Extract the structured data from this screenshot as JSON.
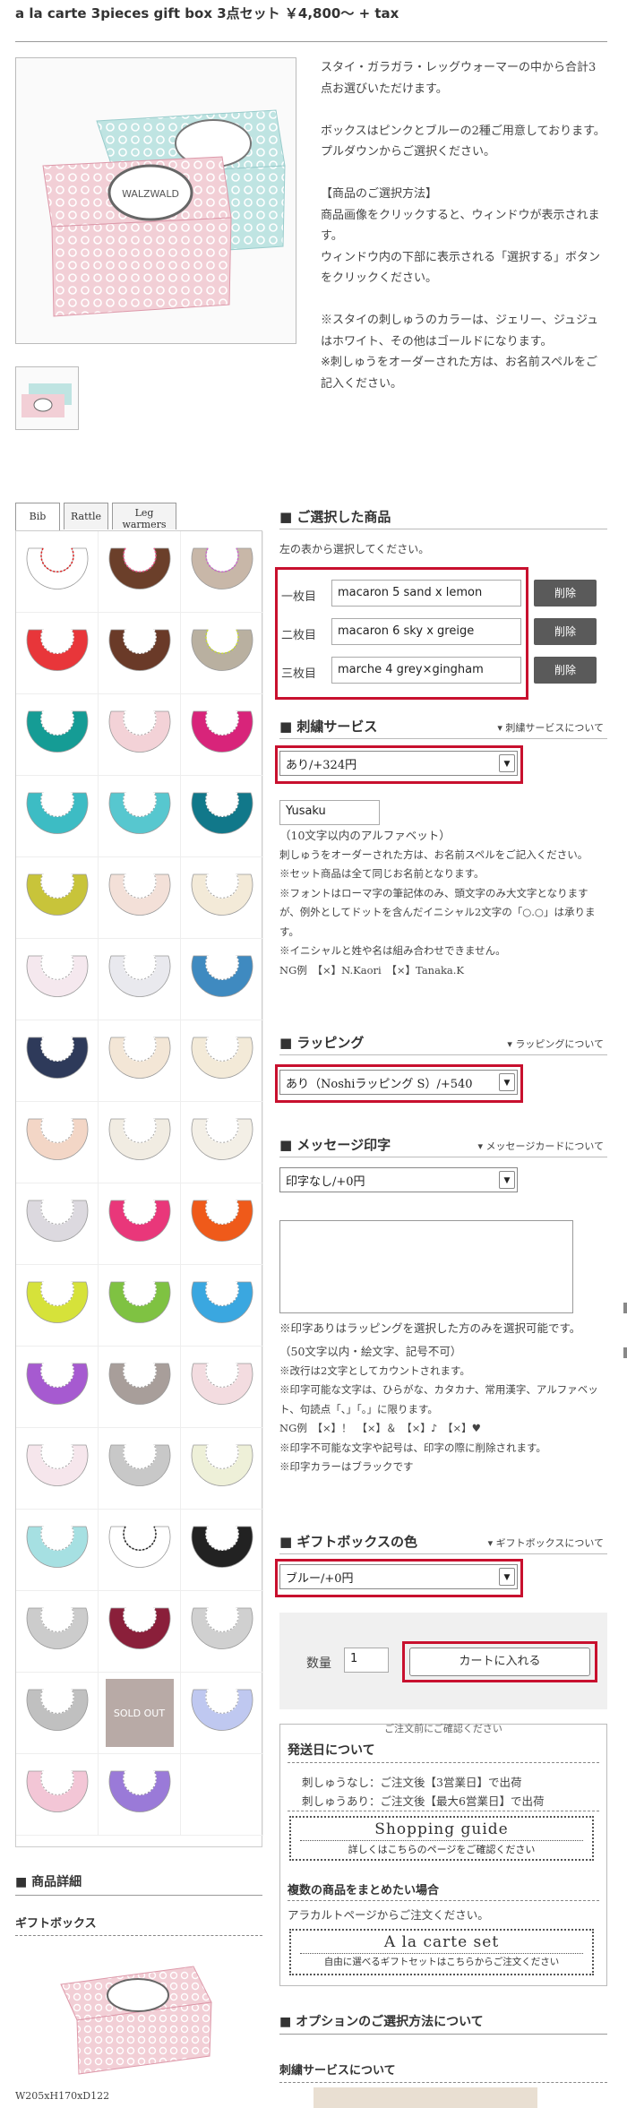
{
  "product_title": "a la carte 3pieces gift box 3点セット ￥4,800～ + tax",
  "description": [
    "スタイ・ガラガラ・レッグウォーマーの中から合計3点お選びいただけます。",
    "ボックスはピンクとブルーの2種ご用意しております。プルダウンからご選択ください。",
    "【商品のご選択方法】\n商品画像をクリックすると、ウィンドウが表示されます。\nウィンドウ内の下部に表示される「選択する」ボタンをクリックください。",
    "※スタイの刺しゅうのカラーは、ジェリー、ジュジュはホワイト、その他はゴールドになります。\n※刺しゅうをオーダーされた方は、お名前スペルをご記入ください。"
  ],
  "box_label": "WALZWALD",
  "tabs": [
    {
      "label": "Bib"
    },
    {
      "label": "Rattle"
    },
    {
      "label": "Leg\nwarmers"
    }
  ],
  "sold_out": "SOLD OUT",
  "selected": {
    "heading": "■ ご選択した商品",
    "instruction": "左の表から選択してください。",
    "items": [
      {
        "label": "一枚目",
        "value": "macaron 5 sand x lemon",
        "delete": "削除"
      },
      {
        "label": "二枚目",
        "value": "macaron 6 sky x greige",
        "delete": "削除"
      },
      {
        "label": "三枚目",
        "value": "marche 4 grey×gingham",
        "delete": "削除"
      }
    ]
  },
  "embroidery": {
    "heading": "■ 刺繍サービス",
    "link": "▾ 刺繍サービスについて",
    "select": "あり/+324円",
    "name_value": "Yusaku",
    "notes": [
      "（10文字以内のアルファベット）",
      "刺しゅうをオーダーされた方は、お名前スペルをご記入ください。",
      "※セット商品は全て同じお名前となります。",
      "※フォントはローマ字の筆記体のみ、頭文字のみ大文字となりますが、例外としてドットを含んだイニシャル2文字の「○.○」は承ります。",
      "※イニシャルと姓や名は組み合わせできません。",
      "NG例　【×】N.Kaori　【×】Tanaka.K"
    ]
  },
  "wrapping": {
    "heading": "■ ラッピング",
    "link": "▾ ラッピングについて",
    "select": "あり（Noshiラッピング S）/+540"
  },
  "message": {
    "heading": "■ メッセージ印字",
    "link": "▾ メッセージカードについて",
    "select": "印字なし/+0円",
    "notes": [
      "※印字ありはラッピングを選択した方のみを選択可能です。",
      "（50文字以内・絵文字、記号不可）",
      "※改行は2文字としてカウントされます。",
      "※印字可能な文字は、ひらがな、カタカナ、常用漢字、アルファベット、句読点「、」「。」に限ります。",
      "NG例　【×】！　【×】＆　【×】♪　【×】♥",
      "※印字不可能な文字や記号は、印字の際に削除されます。",
      "※印字カラーはブラックです"
    ]
  },
  "giftbox": {
    "heading": "■ ギフトボックスの色",
    "link": "▾ ギフトボックスについて",
    "select": "ブルー/+0円"
  },
  "cart": {
    "qty_label": "数量",
    "qty_value": "1",
    "button": "カートに入れる"
  },
  "info": {
    "caption": "ご注文前にご確認ください",
    "ship_heading": "発送日について",
    "ship_lines": [
      "刺しゅうなし：ご注文後【3営業日】で出荷",
      "刺しゅうあり：ご注文後【最大6営業日】で出荷"
    ],
    "guide_title": "Shopping guide",
    "guide_sub": "詳しくはこちらのページをご確認ください",
    "multi_heading": "複数の商品をまとめたい場合",
    "multi_text": "アラカルトページからご注文ください。",
    "alacarte_title": "A la carte set",
    "alacarte_sub": "自由に選べるギフトセットはこちらからご注文ください"
  },
  "detail": {
    "heading": "■ 商品詳細",
    "sub": "ギフトボックス",
    "size": "W205xH170xD122"
  },
  "options": {
    "heading": "■ オプションのご選択方法について",
    "sub": "刺繍サービスについて"
  },
  "colors": {
    "accent_red": "#c8102e",
    "button_gray": "#5a5a5a",
    "box_pink": "#f2cfd6",
    "box_mint": "#bfe4e2"
  }
}
